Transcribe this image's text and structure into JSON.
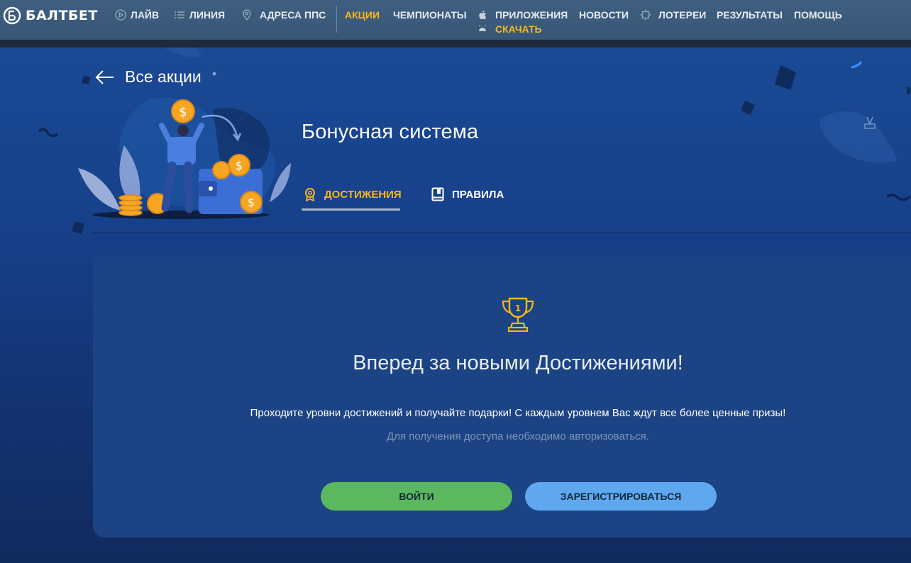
{
  "brand": {
    "name": "БАЛТБЕТ"
  },
  "nav": {
    "live": "Лайв",
    "line": "Линия",
    "addresses": "Адреса ППС",
    "promotions": "Акции",
    "championships": "Чемпионаты",
    "apps": "Приложения",
    "download": "Скачать",
    "news": "Новости",
    "lotteries": "Лотереи",
    "results": "Результаты",
    "help": "Помощь"
  },
  "back_link": {
    "label": "Все акции"
  },
  "page": {
    "title": "Бонусная система"
  },
  "tabs": [
    {
      "label": "Достижения",
      "active": true
    },
    {
      "label": "Правила",
      "active": false
    }
  ],
  "card": {
    "title": "Вперед за новыми Достижениями!",
    "description": "Проходите уровни достижений и получайте подарки! С каждым уровнем Вас ждут все более ценные призы!",
    "note": "Для получения доступа необходимо авторизоваться.",
    "login_label": "Войти",
    "register_label": "Зарегистрироваться"
  },
  "colors": {
    "accent": "#f6b81b",
    "login": "#5cb85f",
    "register": "#5fa8f0",
    "topbar": "#3d5c7d"
  }
}
